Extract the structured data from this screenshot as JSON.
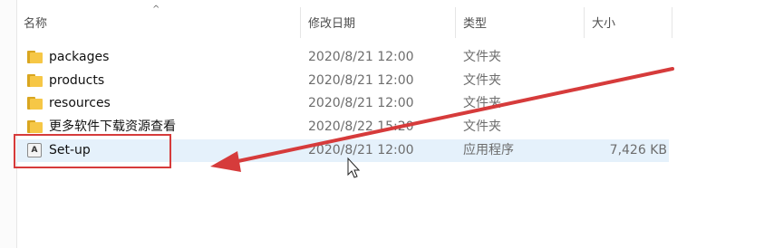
{
  "columns": {
    "name": "名称",
    "modified": "修改日期",
    "type": "类型",
    "size": "大小"
  },
  "sort_indicator": "^",
  "files": [
    {
      "name": "packages",
      "modified": "2020/8/21 12:00",
      "type": "文件夹",
      "size": "",
      "icon": "folder-icon"
    },
    {
      "name": "products",
      "modified": "2020/8/21 12:00",
      "type": "文件夹",
      "size": "",
      "icon": "folder-icon"
    },
    {
      "name": "resources",
      "modified": "2020/8/21 12:00",
      "type": "文件夹",
      "size": "",
      "icon": "folder-icon"
    },
    {
      "name": "更多软件下载资源查看",
      "modified": "2020/8/22 15:20",
      "type": "文件夹",
      "size": "",
      "icon": "folder-icon"
    },
    {
      "name": "Set-up",
      "modified": "2020/8/21 12:00",
      "type": "应用程序",
      "size": "7,426 KB",
      "icon": "adobe-app-icon",
      "selected": true
    }
  ],
  "app_icon_glyph": "A",
  "colors": {
    "selection": "#e5f1fb",
    "annotation": "#d63b3b",
    "folder": "#f6c746"
  }
}
